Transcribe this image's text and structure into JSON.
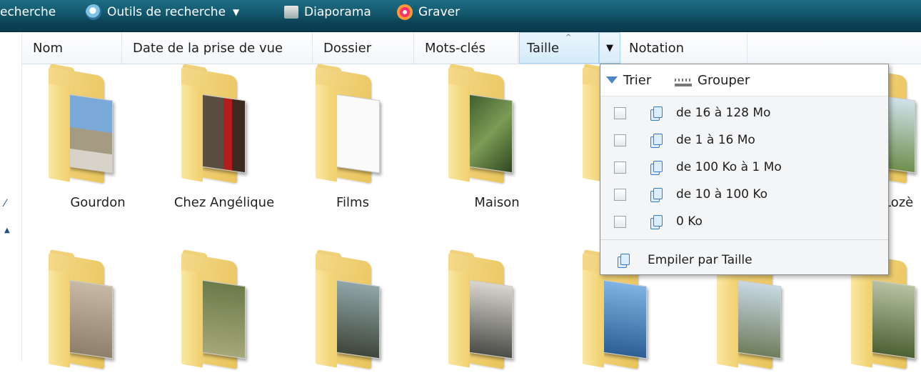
{
  "toolbar": {
    "items": [
      {
        "label": "echerche"
      },
      {
        "label": "Outils de recherche",
        "icon": "search-icon"
      },
      {
        "label": "Diaporama",
        "icon": "slideshow-icon"
      },
      {
        "label": "Graver",
        "icon": "burn-disc-icon"
      }
    ],
    "colors": {
      "bar": "#13566c",
      "text": "#ffffff"
    }
  },
  "columns": [
    {
      "label": "Nom"
    },
    {
      "label": "Date de la prise de vue"
    },
    {
      "label": "Dossier"
    },
    {
      "label": "Mots-clés"
    },
    {
      "label": "Taille",
      "sorted": true
    },
    {
      "label": "Notation"
    }
  ],
  "folders_row1": [
    {
      "label": "Gourdon"
    },
    {
      "label": "Chez Angélique"
    },
    {
      "label": "Films"
    },
    {
      "label": "Maison"
    },
    {
      "label": "Lozè"
    }
  ],
  "menu": {
    "sort_label": "Trier",
    "group_label": "Grouper",
    "options": [
      {
        "label": "de 16 à 128 Mo",
        "checked": false
      },
      {
        "label": "de 1 à 16 Mo",
        "checked": false
      },
      {
        "label": "de 100 Ko à 1 Mo",
        "checked": false
      },
      {
        "label": "de 10 à 100 Ko",
        "checked": false
      },
      {
        "label": "0 Ko",
        "checked": false
      }
    ],
    "stack_label": "Empiler par Taille"
  }
}
